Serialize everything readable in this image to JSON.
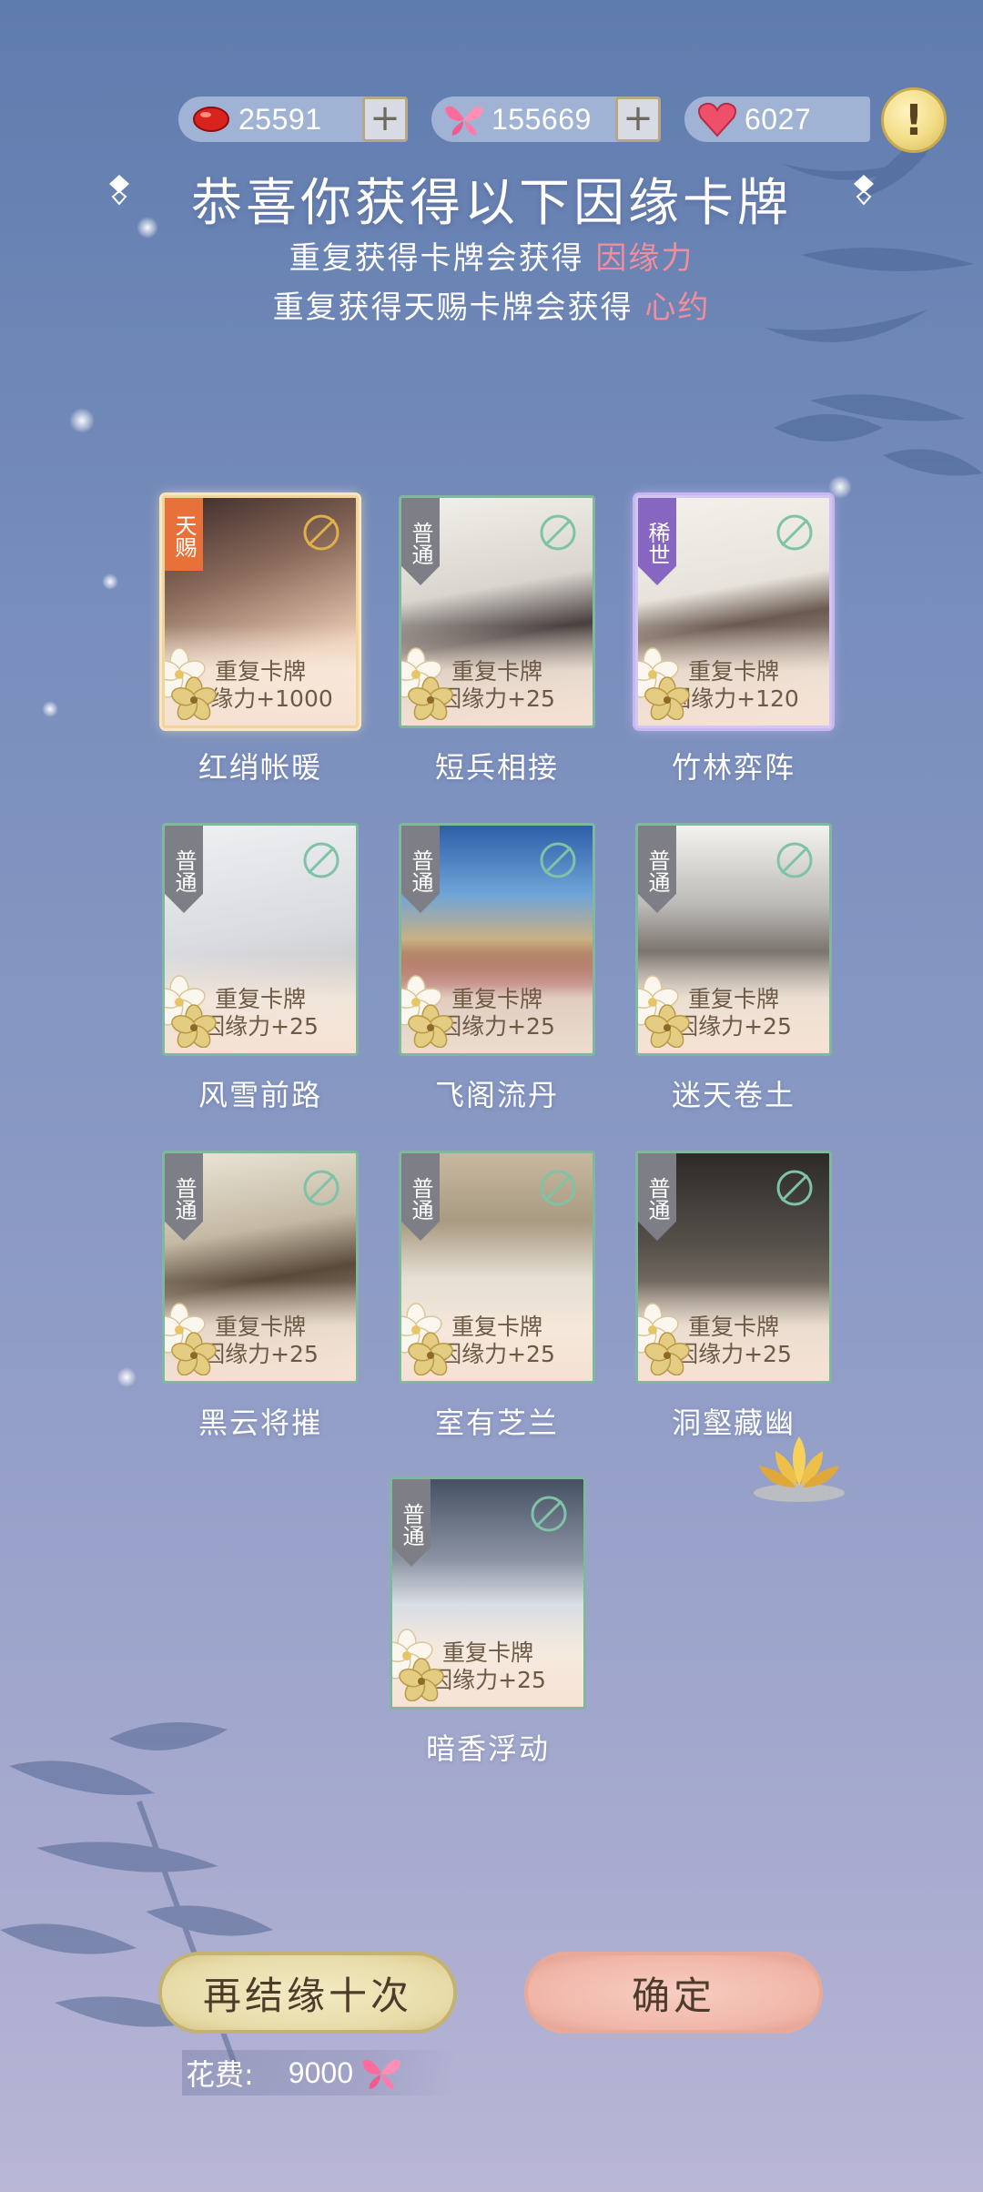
{
  "currencies": [
    {
      "icon": "red-bean-icon",
      "value": "25591",
      "has_plus": true
    },
    {
      "icon": "pink-butterfly-icon",
      "value": "155669",
      "has_plus": true
    },
    {
      "icon": "heart-icon",
      "value": "6027",
      "has_plus": false
    }
  ],
  "title": "恭喜你获得以下因缘卡牌",
  "subtitle1": {
    "text": "重复获得卡牌会获得 ",
    "highlight": "因缘力"
  },
  "subtitle2": {
    "text": "重复获得天赐卡牌会获得 ",
    "highlight": "心约"
  },
  "cards": [
    {
      "rarity": "天赐",
      "tier": "gold",
      "dup_line1": "重复卡牌",
      "dup_line2": "因缘力+1000",
      "name": "红绡帐暖"
    },
    {
      "rarity": "普通",
      "tier": "normal",
      "dup_line1": "重复卡牌",
      "dup_line2": "因缘力+25",
      "name": "短兵相接"
    },
    {
      "rarity": "稀世",
      "tier": "purple",
      "dup_line1": "重复卡牌",
      "dup_line2": "因缘力+120",
      "name": "竹林弈阵"
    },
    {
      "rarity": "普通",
      "tier": "normal",
      "dup_line1": "重复卡牌",
      "dup_line2": "因缘力+25",
      "name": "风雪前路"
    },
    {
      "rarity": "普通",
      "tier": "normal",
      "dup_line1": "重复卡牌",
      "dup_line2": "因缘力+25",
      "name": "飞阁流丹"
    },
    {
      "rarity": "普通",
      "tier": "normal",
      "dup_line1": "重复卡牌",
      "dup_line2": "因缘力+25",
      "name": "迷天卷土"
    },
    {
      "rarity": "普通",
      "tier": "normal",
      "dup_line1": "重复卡牌",
      "dup_line2": "因缘力+25",
      "name": "黑云将摧"
    },
    {
      "rarity": "普通",
      "tier": "normal",
      "dup_line1": "重复卡牌",
      "dup_line2": "因缘力+25",
      "name": "室有芝兰"
    },
    {
      "rarity": "普通",
      "tier": "normal",
      "dup_line1": "重复卡牌",
      "dup_line2": "因缘力+25",
      "name": "洞壑藏幽"
    },
    {
      "rarity": "普通",
      "tier": "normal",
      "dup_line1": "重复卡牌",
      "dup_line2": "因缘力+25",
      "name": "暗香浮动"
    }
  ],
  "buttons": {
    "again": "再结缘十次",
    "confirm": "确定"
  },
  "cost": {
    "label": "花费:",
    "value": "9000",
    "icon": "pink-butterfly-icon"
  },
  "colors": {
    "highlight": "#f28e9c",
    "gold_tag": "#e8713a",
    "purple_tag": "#8766c1",
    "normal_tag": "#7e7f86"
  }
}
